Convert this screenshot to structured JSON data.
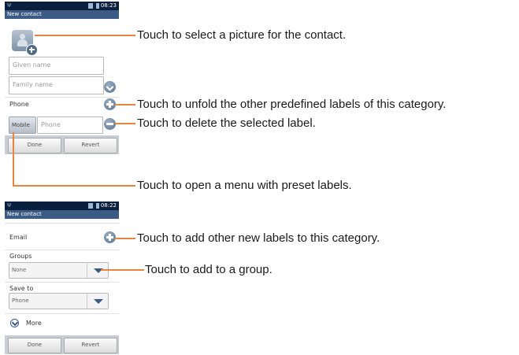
{
  "screen1": {
    "status_time": "08:23",
    "title": "New contact",
    "given_name_placeholder": "Given name",
    "family_name_placeholder": "Family name",
    "phone_label": "Phone",
    "mobile_label": "Mobile",
    "phone_placeholder": "Phone",
    "done_label": "Done",
    "revert_label": "Revert"
  },
  "screen2": {
    "status_time": "08:22",
    "title": "New contact",
    "email_label": "Email",
    "groups_label": "Groups",
    "groups_value": "None",
    "save_to_label": "Save to",
    "save_to_value": "Phone",
    "more_label": "More",
    "done_label": "Done",
    "revert_label": "Revert"
  },
  "callouts": {
    "picture": "Touch to select a picture for the contact.",
    "unfold": "Touch to unfold the other predefined labels of this category.",
    "delete": "Touch to delete the selected label.",
    "menu": "Touch to open a menu with preset labels.",
    "add_labels": "Touch to add other new labels to this category.",
    "group": "Touch to add to a group."
  },
  "colors": {
    "accent": "#e8853f",
    "statusbar": "#0a1f3d",
    "titlebar": "#3b5a84"
  }
}
